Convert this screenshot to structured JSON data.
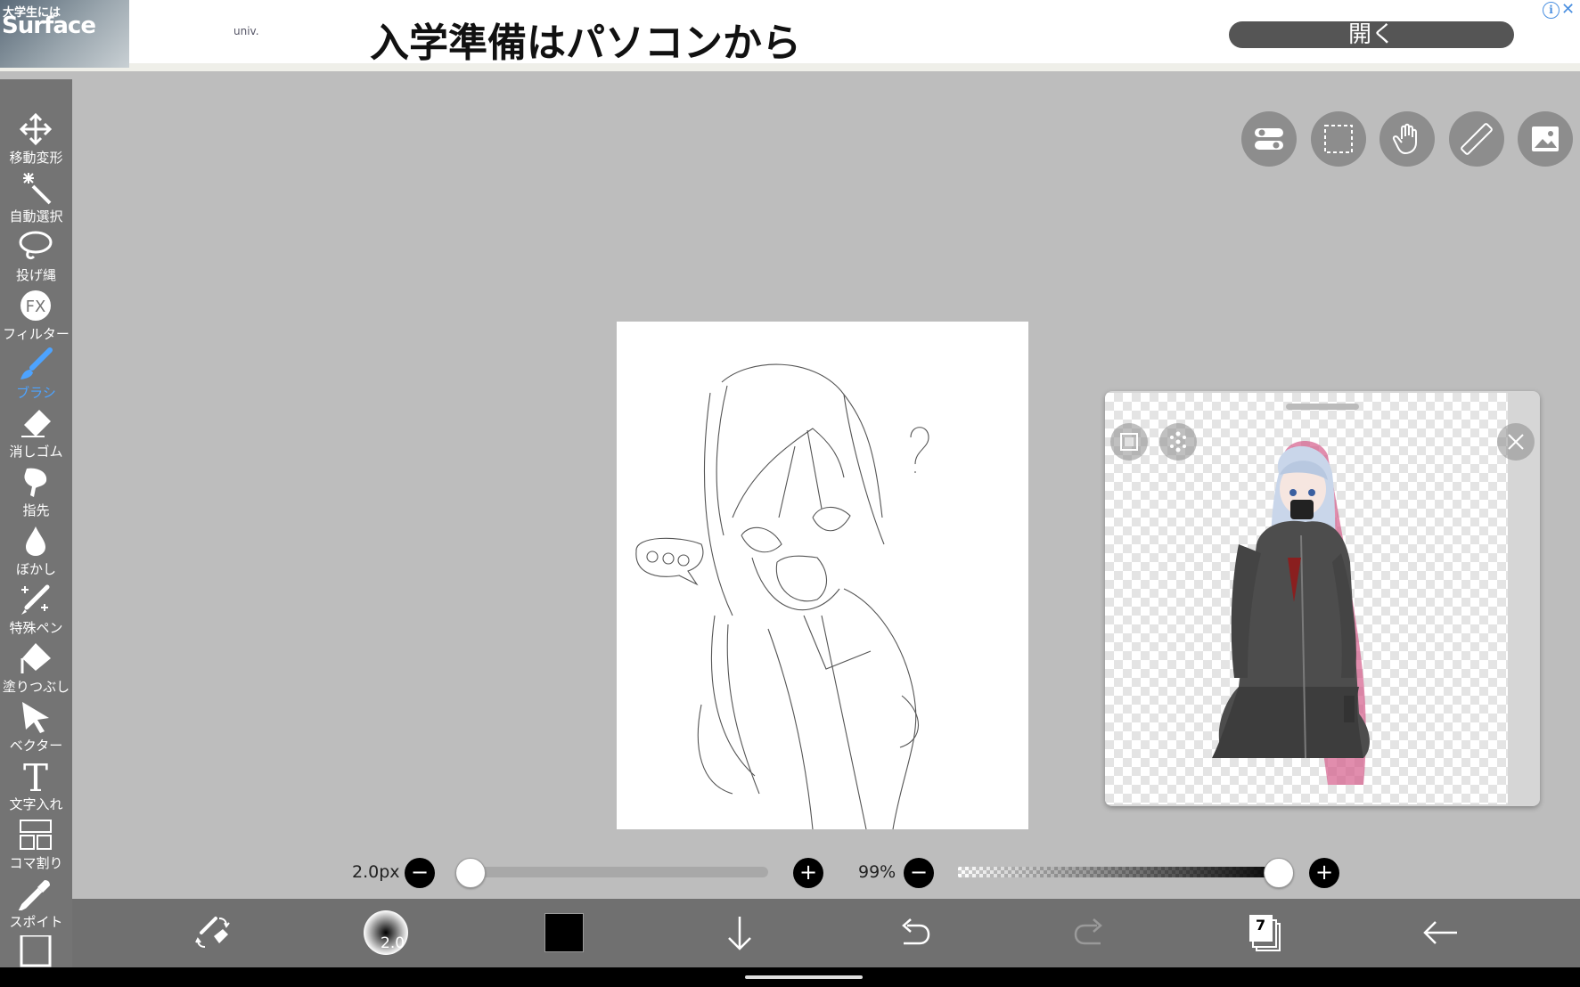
{
  "ad": {
    "thumb_line1": "大学生には",
    "thumb_line2": "Surface",
    "logo": "univ.",
    "headline": "入学準備はパソコンから",
    "open_button": "開く",
    "info": "i",
    "close": "✕"
  },
  "tools": [
    {
      "label": "移動変形",
      "icon": "move-icon"
    },
    {
      "label": "自動選択",
      "icon": "magic-wand-icon"
    },
    {
      "label": "投げ縄",
      "icon": "lasso-icon"
    },
    {
      "label": "フィルター",
      "icon": "fx-icon",
      "glyph": "FX"
    },
    {
      "label": "ブラシ",
      "icon": "brush-icon",
      "active": true
    },
    {
      "label": "消しゴム",
      "icon": "eraser-icon"
    },
    {
      "label": "指先",
      "icon": "finger-icon"
    },
    {
      "label": "ぼかし",
      "icon": "blur-drop-icon"
    },
    {
      "label": "特殊ペン",
      "icon": "special-pen-icon"
    },
    {
      "label": "塗りつぶし",
      "icon": "fill-bucket-icon"
    },
    {
      "label": "ベクター",
      "icon": "vector-cursor-icon"
    },
    {
      "label": "文字入れ",
      "icon": "text-icon",
      "glyph": "T"
    },
    {
      "label": "コマ割り",
      "icon": "panel-layout-icon"
    },
    {
      "label": "スポイト",
      "icon": "eyedropper-icon"
    }
  ],
  "top_buttons": [
    "toggle-settings-icon",
    "selection-rect-icon",
    "hand-icon",
    "ruler-icon",
    "image-icon"
  ],
  "sliders": {
    "brush_size_label": "2.0px",
    "brush_size_value": 0.0,
    "opacity_label": "99%",
    "opacity_value": 0.99,
    "minus": "−",
    "plus": "+"
  },
  "bottom_bar": {
    "brush_preview_size": "2.0",
    "current_color": "#000000",
    "layer_count": "7"
  }
}
